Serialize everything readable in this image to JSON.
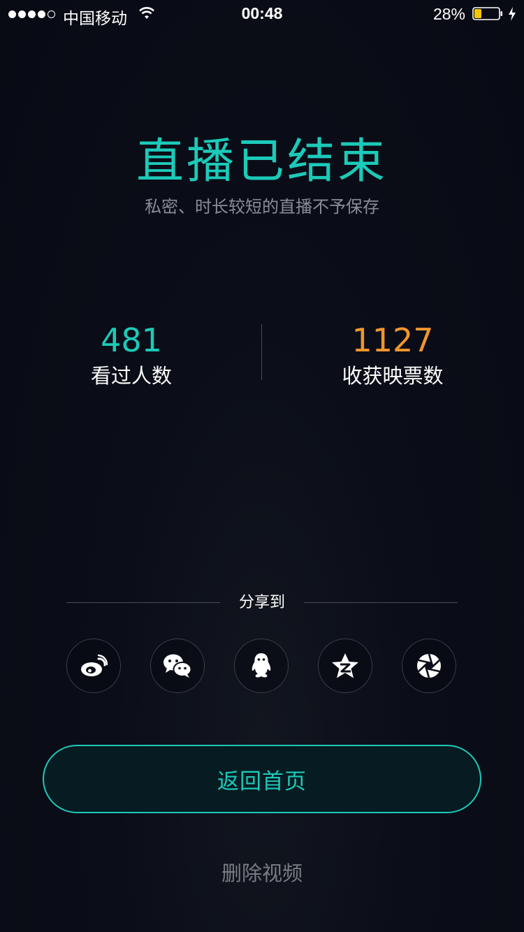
{
  "status_bar": {
    "carrier": "中国移动",
    "time": "00:48",
    "battery_percent": "28%",
    "signal_bars_filled": 4,
    "signal_bars_total": 5,
    "battery_level": 0.28,
    "charging": true
  },
  "title": "直播已结束",
  "subtitle": "私密、时长较短的直播不予保存",
  "stats": {
    "viewers": {
      "value": "481",
      "label": "看过人数"
    },
    "tickets": {
      "value": "1127",
      "label": "收获映票数"
    }
  },
  "share": {
    "label": "分享到",
    "targets": [
      {
        "icon": "weibo-icon"
      },
      {
        "icon": "wechat-icon"
      },
      {
        "icon": "qq-icon"
      },
      {
        "icon": "qzone-icon"
      },
      {
        "icon": "moments-icon"
      }
    ]
  },
  "actions": {
    "home_label": "返回首页",
    "delete_label": "删除视频"
  },
  "colors": {
    "accent": "#1ccab8",
    "tickets": "#f0962e",
    "background": "#0b0e18",
    "muted": "#8a8d96"
  }
}
